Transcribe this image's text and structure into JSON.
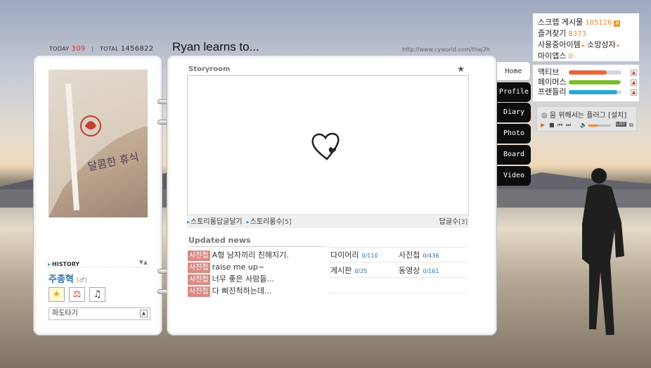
{
  "header": {
    "today_label": "TODAY",
    "today_count": "309",
    "total_label": "TOTAL",
    "total_count": "1456822",
    "title": "Ryan learns to...",
    "url": "http://www.cyworld.com/thej2h"
  },
  "profile": {
    "photo_caption": "달콤한 휴식",
    "history_label": "HISTORY",
    "owner_name": "주종혁",
    "owner_gender": "(♂)",
    "surf_label": "파도타기"
  },
  "storyroom": {
    "title": "Storyroom",
    "reply_link": "스토리룸답글달기",
    "count_link": "스토리룸수",
    "count_value": "[5]",
    "reply_count_label": "답글수",
    "reply_count_value": "[3]"
  },
  "updated_news": {
    "title": "Updated news",
    "items": [
      {
        "tag": "사진첩",
        "text": "A형 남자끼리 친해지기."
      },
      {
        "tag": "사진첩",
        "text": "raise me up~"
      },
      {
        "tag": "사진첩",
        "text": "너무 좋은 사람들..."
      },
      {
        "tag": "사진첩",
        "text": "다 삐진척하는데..."
      }
    ]
  },
  "stats": {
    "diary_label": "다이어리",
    "diary_value": "0/110",
    "photo_label": "사진첩",
    "photo_value": "0/436",
    "board_label": "게시판",
    "board_value": "0/25",
    "video_label": "동영상",
    "video_value": "0/161"
  },
  "tabs": [
    "Home",
    "Profile",
    "Diary",
    "Photo",
    "Board",
    "Video"
  ],
  "sidebar": {
    "scrap_label": "스크랩 게시물",
    "scrap_value": "185126",
    "fav_label": "즐겨찾기",
    "fav_value": "8373",
    "items_label": "사용중아이템",
    "consume_label": "소망상자",
    "myapps_label": "마이앱스",
    "myapps_value": "0"
  },
  "activity": [
    {
      "label": "액티브",
      "fill": 0.72,
      "color": "#e8663a"
    },
    {
      "label": "페이머스",
      "fill": 0.97,
      "color": "#7cbd2a"
    },
    {
      "label": "프랜들리",
      "fill": 0.92,
      "color": "#2aa7d6"
    }
  ],
  "player": {
    "notice": "음 위해서는 플러그 [설치]",
    "list_label": "LIST",
    "volume": 0.4
  }
}
